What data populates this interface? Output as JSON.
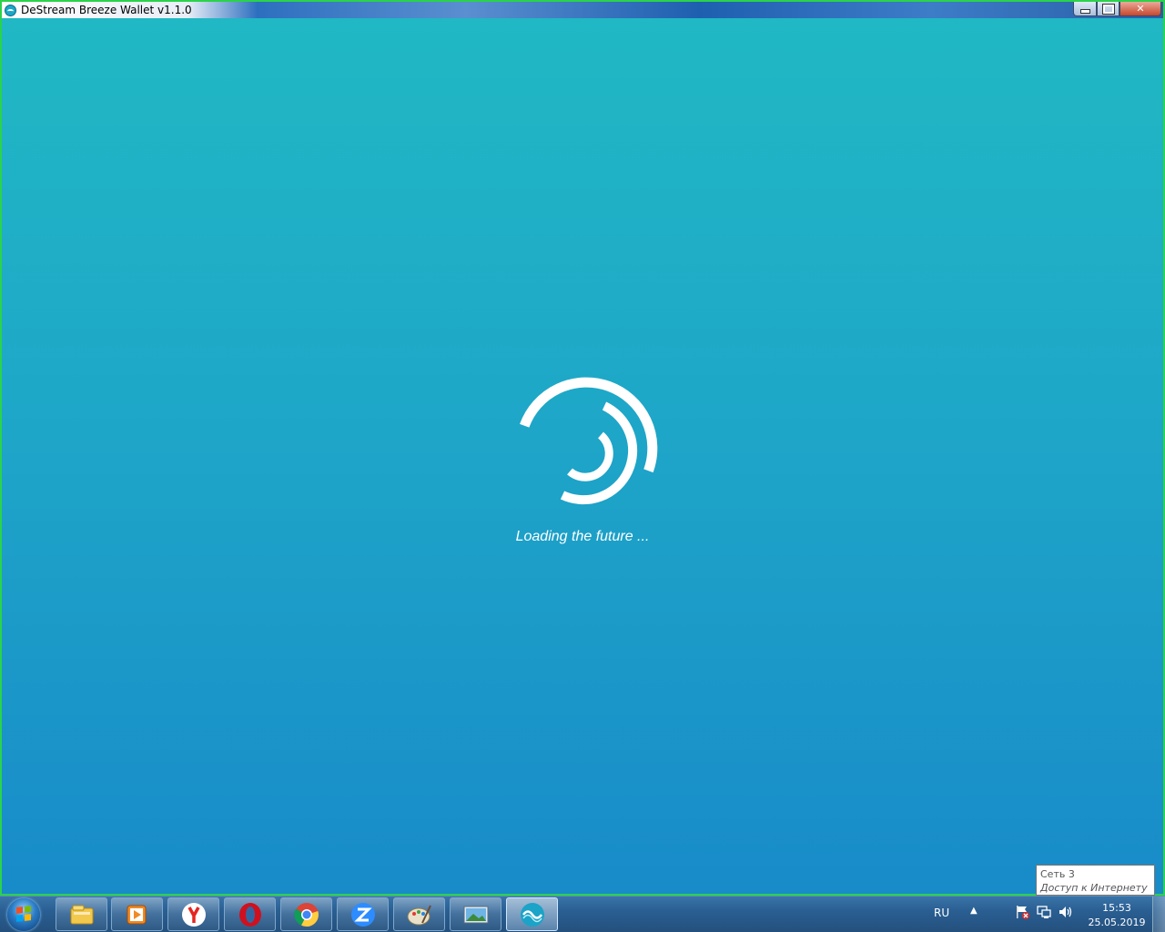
{
  "window": {
    "title": "DeStream Breeze Wallet v1.1.0",
    "icon": "destream-logo-icon",
    "controls": [
      "minimize-icon",
      "maximize-icon",
      "close-icon"
    ]
  },
  "splash": {
    "loading_text": "Loading the future ...",
    "spinner_icon": "destream-spinner-icon",
    "background_top": "#20b8c4",
    "background_bottom": "#188bc9"
  },
  "taskbar": {
    "pinned": [
      {
        "name": "file-explorer-icon"
      },
      {
        "name": "media-player-icon"
      },
      {
        "name": "yandex-browser-icon"
      },
      {
        "name": "opera-browser-icon"
      },
      {
        "name": "chrome-browser-icon"
      },
      {
        "name": "zoom-icon"
      },
      {
        "name": "paint-icon"
      },
      {
        "name": "photo-viewer-icon"
      },
      {
        "name": "destream-wallet-icon",
        "active": true
      }
    ],
    "language": "RU",
    "clock_time": "15:53",
    "clock_date": "25.05.2019"
  },
  "tooltip": {
    "line1": "Сеть  3",
    "line2": "Доступ к Интернету"
  }
}
